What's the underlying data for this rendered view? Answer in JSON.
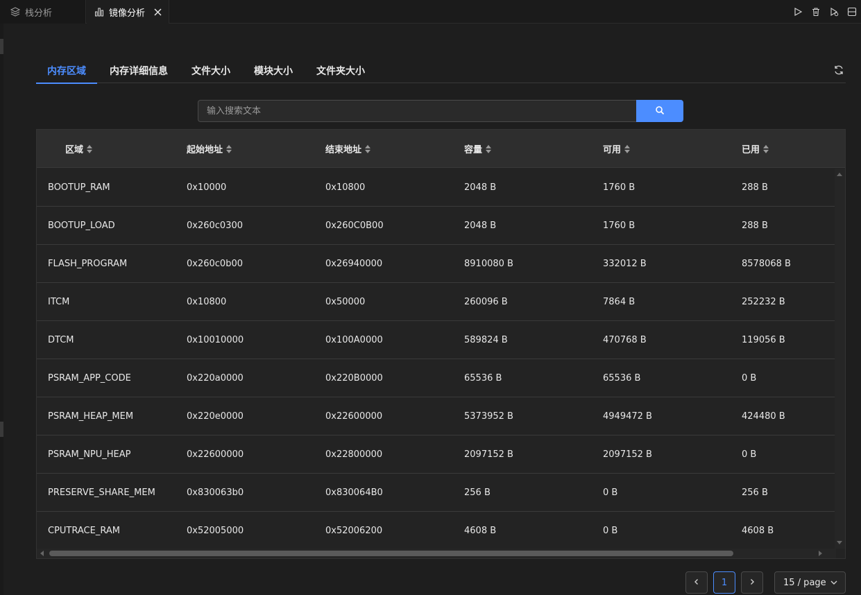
{
  "editor_tabs": [
    {
      "label": "栈分析",
      "icon": "layers-icon",
      "active": false
    },
    {
      "label": "镜像分析",
      "icon": "bar-chart-icon",
      "active": true
    }
  ],
  "tab_actions": [
    "play-icon",
    "trash-icon",
    "run-debug-icon",
    "split-editor-icon"
  ],
  "analysis_tabs": [
    {
      "label": "内存区域",
      "active": true
    },
    {
      "label": "内存详细信息",
      "active": false
    },
    {
      "label": "文件大小",
      "active": false
    },
    {
      "label": "模块大小",
      "active": false
    },
    {
      "label": "文件夹大小",
      "active": false
    }
  ],
  "search": {
    "placeholder": "输入搜索文本",
    "value": ""
  },
  "table": {
    "columns": [
      "区域",
      "起始地址",
      "结束地址",
      "容量",
      "可用",
      "已用"
    ],
    "rows": [
      [
        "BOOTUP_RAM",
        "0x10000",
        "0x10800",
        "2048 B",
        "1760 B",
        "288 B"
      ],
      [
        "BOOTUP_LOAD",
        "0x260c0300",
        "0x260C0B00",
        "2048 B",
        "1760 B",
        "288 B"
      ],
      [
        "FLASH_PROGRAM",
        "0x260c0b00",
        "0x26940000",
        "8910080 B",
        "332012 B",
        "8578068 B"
      ],
      [
        "ITCM",
        "0x10800",
        "0x50000",
        "260096 B",
        "7864 B",
        "252232 B"
      ],
      [
        "DTCM",
        "0x10010000",
        "0x100A0000",
        "589824 B",
        "470768 B",
        "119056 B"
      ],
      [
        "PSRAM_APP_CODE",
        "0x220a0000",
        "0x220B0000",
        "65536 B",
        "65536 B",
        "0 B"
      ],
      [
        "PSRAM_HEAP_MEM",
        "0x220e0000",
        "0x22600000",
        "5373952 B",
        "4949472 B",
        "424480 B"
      ],
      [
        "PSRAM_NPU_HEAP",
        "0x22600000",
        "0x22800000",
        "2097152 B",
        "2097152 B",
        "0 B"
      ],
      [
        "PRESERVE_SHARE_MEM",
        "0x830063b0",
        "0x830064B0",
        "256 B",
        "0 B",
        "256 B"
      ],
      [
        "CPUTRACE_RAM",
        "0x52005000",
        "0x52006200",
        "4608 B",
        "0 B",
        "4608 B"
      ]
    ]
  },
  "pagination": {
    "current_page": "1",
    "page_size": "15 / page"
  },
  "colors": {
    "accent": "#4c8dff",
    "background": "#1e1e1e"
  }
}
